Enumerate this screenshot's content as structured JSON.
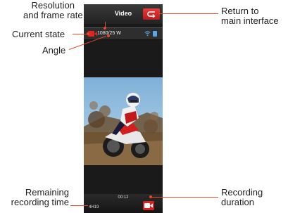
{
  "annotations": {
    "resolution_line1": "Resolution",
    "resolution_line2": "and frame rate",
    "current_state": "Current state",
    "angle": "Angle",
    "return_line1": "Return to",
    "return_line2": "main interface",
    "remaining_line1": "Remaining",
    "remaining_line2": "recording time",
    "recording_line1": "Recording",
    "recording_line2": "duration"
  },
  "screen": {
    "title": "Video",
    "status": {
      "resolution_text": "1080/25 W",
      "state_icon": "video-camera-icon",
      "wifi_icon": "wifi-icon",
      "storage_icon": "sd-card-icon"
    },
    "photo": {
      "description_icon": "motocross-photo"
    },
    "bottom": {
      "duration": "00:12",
      "remaining": "4H19",
      "record_icon": "video-camera-icon"
    },
    "back_icon": "return-arrow-icon"
  },
  "colors": {
    "accent_red": "#e02525",
    "annotation_line": "#e04a2a",
    "background_dark": "#1a1a1a"
  }
}
